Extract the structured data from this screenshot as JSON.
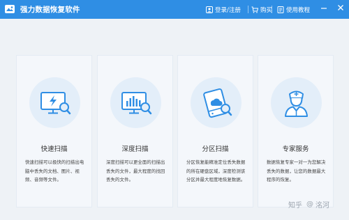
{
  "app": {
    "title": "强力数据恢复软件",
    "accent": "#2f8ee4"
  },
  "toolbar": {
    "login_label": "登录/注册",
    "buy_label": "购买",
    "tutorial_label": "使用教程"
  },
  "cards": [
    {
      "title": "快速扫描",
      "icon": "monitor-lightning-magnifier-icon",
      "description": "快速扫描可以极快的扫描出电脑中丢失的文档、图片、视频、音频等文件。"
    },
    {
      "title": "深度扫描",
      "icon": "monitor-chart-magnifier-icon",
      "description": "深度扫描可以更全面的扫描出丢失的文件，最大程度的找回丢失的文件。"
    },
    {
      "title": "分区扫描",
      "icon": "disk-cloud-magnifier-icon",
      "description": "分区恢复能精准定位丢失数据的所在硬盘区域，深度检测该分区并最大程度地恢复数据。"
    },
    {
      "title": "专家服务",
      "icon": "expert-person-icon",
      "description": "数据恢复专家一对一为您解决丢失的数据，让您的数据最大程序的恢复。"
    }
  ],
  "watermark": {
    "site": "知乎",
    "user": "洺河"
  }
}
